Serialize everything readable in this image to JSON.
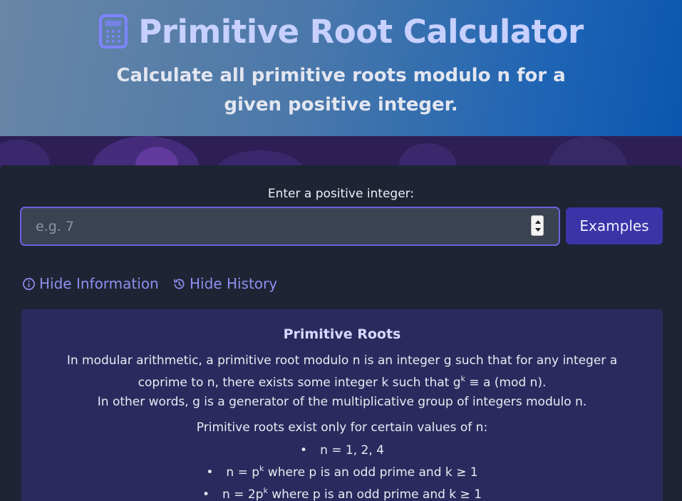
{
  "header": {
    "title": "Primitive Root Calculator",
    "subtitle": "Calculate all primitive roots modulo n for a given positive integer."
  },
  "input": {
    "label": "Enter a positive integer:",
    "placeholder": "e.g. 7",
    "value": ""
  },
  "examples_button": "Examples",
  "toggles": {
    "info_label": "Hide Information",
    "history_label": "Hide History"
  },
  "info": {
    "title": "Primitive Roots",
    "p1_text": "In modular arithmetic, a primitive root modulo n is an integer g such that for any integer a coprime to n, there exists some integer k such that g",
    "p1_sup": "k",
    "p1_tail": " ≡ a (mod n).",
    "p2": "In other words, g is a generator of the multiplicative group of integers modulo n.",
    "p3": "Primitive roots exist only for certain values of n:",
    "list": [
      {
        "pre": "n = 1, 2, 4",
        "sup": "",
        "post": ""
      },
      {
        "pre": "n = p",
        "sup": "k",
        "post": " where p is an odd prime and k ≥ 1"
      },
      {
        "pre": "n = 2p",
        "sup": "k",
        "post": " where p is an odd prime and k ≥ 1"
      }
    ]
  },
  "colors": {
    "accent": "#6b63e0",
    "button": "#3b33a8",
    "link": "#8f8ef0",
    "panel": "#1e2433"
  },
  "icons": [
    "calculator-icon",
    "info-icon",
    "history-icon"
  ]
}
